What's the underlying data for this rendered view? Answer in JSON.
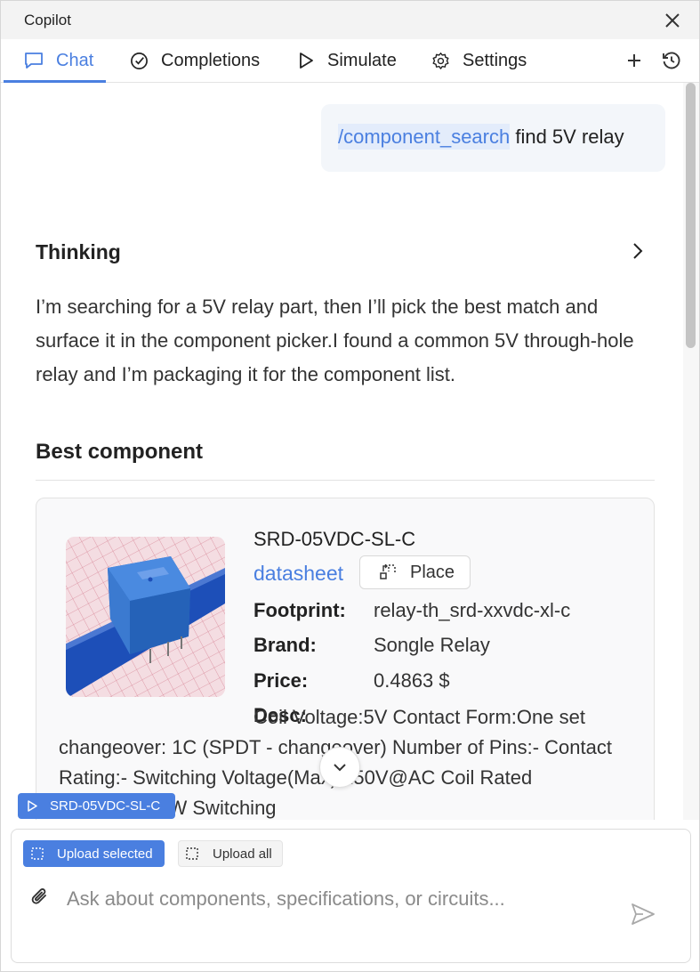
{
  "window": {
    "title": "Copilot"
  },
  "tabs": [
    {
      "label": "Chat",
      "icon": "chat-bubble-icon",
      "active": true
    },
    {
      "label": "Completions",
      "icon": "check-circle-icon",
      "active": false
    },
    {
      "label": "Simulate",
      "icon": "play-icon",
      "active": false
    },
    {
      "label": "Settings",
      "icon": "gear-icon",
      "active": false
    }
  ],
  "header_actions": {
    "new_chat_icon": "plus-icon",
    "history_icon": "history-icon"
  },
  "user_message": {
    "command": "/component_search",
    "text": " find 5V relay"
  },
  "thinking": {
    "title": "Thinking",
    "text": "I’m searching for a 5V relay part, then I’ll pick the best match and surface it in the component picker.I found a common 5V through-hole relay and I’m packaging it for the component list."
  },
  "best_component": {
    "section_title": "Best component",
    "name": "SRD-05VDC-SL-C",
    "datasheet_label": "datasheet",
    "place_label": "Place",
    "fields": {
      "footprint_label": "Footprint:",
      "footprint_value": "relay-th_srd-xxvdc-xl-c",
      "brand_label": "Brand:",
      "brand_value": "Songle Relay",
      "price_label": "Price:",
      "price_value": "0.4863 $",
      "desc_label": "Desc:",
      "desc_value": "Coil Voltage:5V Contact Form:One set changeover: 1C (SPDT - changeover) Number of Pins:- Contact Rating:- Switching Voltage(Max):250V@AC Coil Rated Power:360mW Switching"
    }
  },
  "selected_chip": {
    "label": "SRD-05VDC-SL-C"
  },
  "composer": {
    "upload_selected_label": "Upload selected",
    "upload_all_label": "Upload all",
    "placeholder": "Ask about components, specifications, or circuits..."
  },
  "colors": {
    "accent": "#4a7fe0",
    "relay_body": "#2f6fc6",
    "pcb": "#1d4fb8"
  }
}
